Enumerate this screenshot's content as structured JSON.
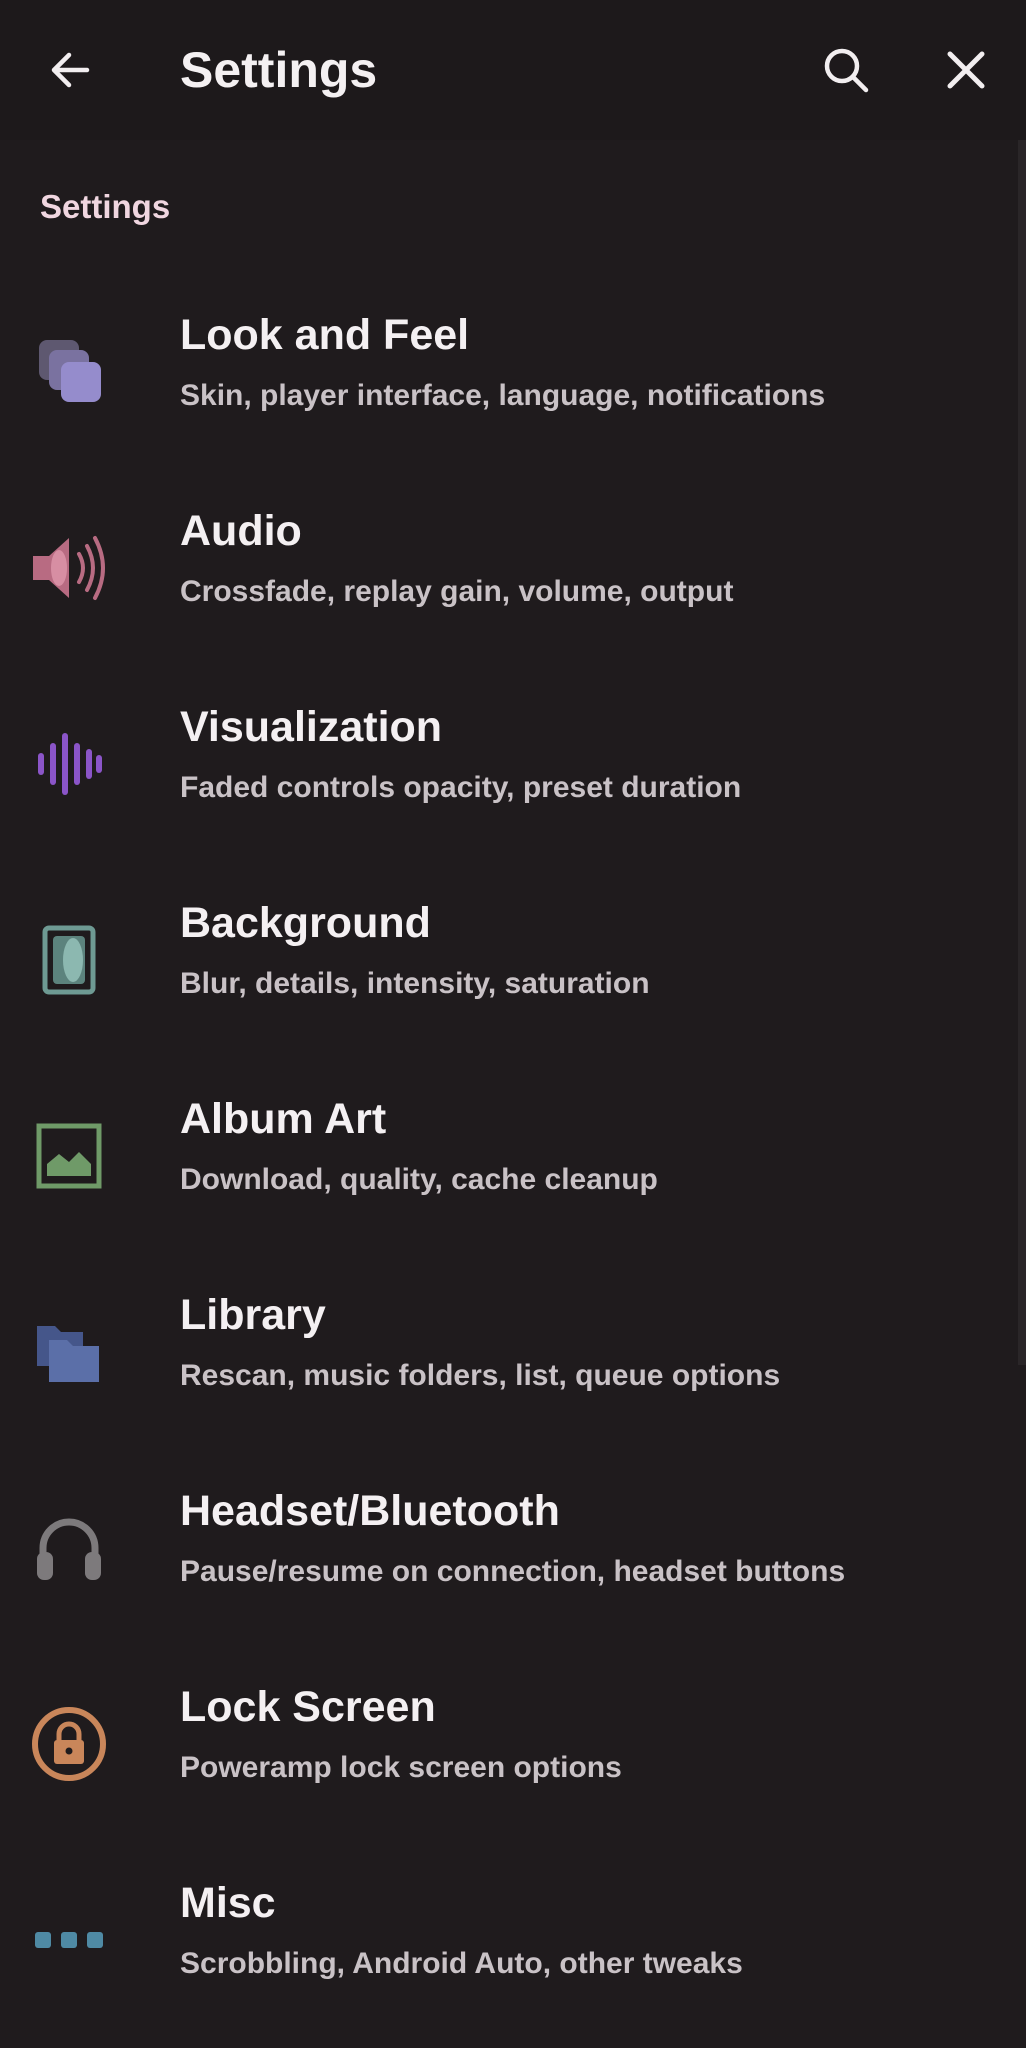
{
  "appbar": {
    "title": "Settings"
  },
  "section": {
    "header": "Settings"
  },
  "items": [
    {
      "title": "Look and Feel",
      "subtitle": "Skin, player interface, language, notifications",
      "icon": "layers-icon",
      "color": "#8f86c2"
    },
    {
      "title": "Audio",
      "subtitle": "Crossfade, replay gain, volume, output",
      "icon": "speaker-icon",
      "color": "#b86b82"
    },
    {
      "title": "Visualization",
      "subtitle": "Faded controls opacity, preset duration",
      "icon": "waveform-icon",
      "color": "#8b55c8"
    },
    {
      "title": "Background",
      "subtitle": "Blur, details, intensity, saturation",
      "icon": "wallpaper-icon",
      "color": "#6e9a93"
    },
    {
      "title": "Album Art",
      "subtitle": "Download, quality, cache cleanup",
      "icon": "image-icon",
      "color": "#6f9a68"
    },
    {
      "title": "Library",
      "subtitle": "Rescan, music folders, list, queue options",
      "icon": "folders-icon",
      "color": "#5b6fa8"
    },
    {
      "title": "Headset/Bluetooth",
      "subtitle": "Pause/resume on connection, headset buttons",
      "icon": "headphones-icon",
      "color": "#7d7a7c"
    },
    {
      "title": "Lock Screen",
      "subtitle": "Poweramp lock screen options",
      "icon": "lock-icon",
      "color": "#c9865a"
    },
    {
      "title": "Misc",
      "subtitle": "Scrobbling, Android Auto, other tweaks",
      "icon": "dots-icon",
      "color": "#4f8aa4"
    }
  ]
}
